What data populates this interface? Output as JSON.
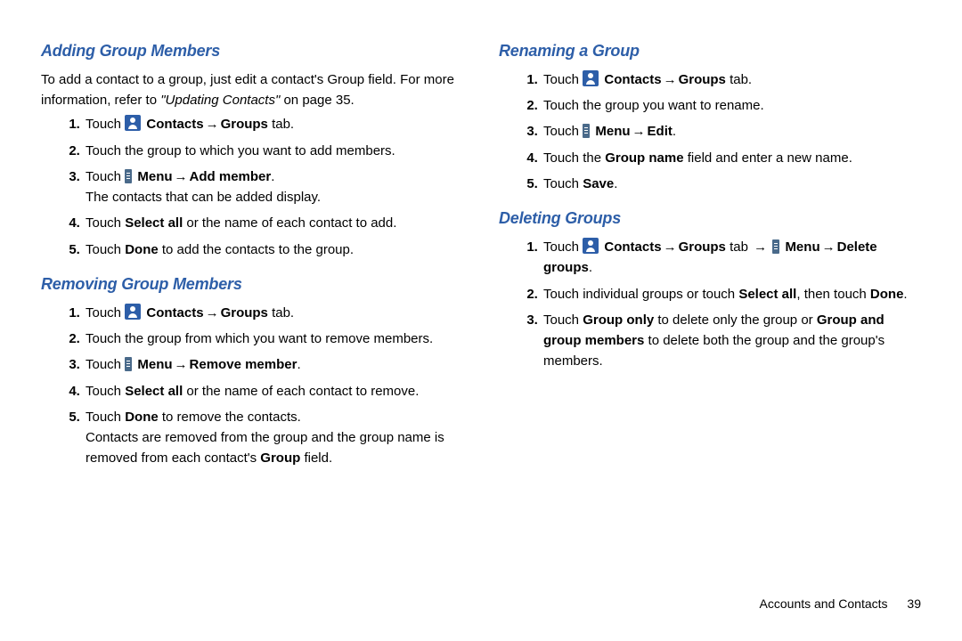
{
  "left": {
    "h1": "Adding Group Members",
    "intro1": "To add a contact to a group, just edit a contact's Group field. For more information, refer to ",
    "intro1_ref": "\"Updating Contacts\"",
    "intro1_tail": " on page 35.",
    "a1_pre": "Touch ",
    "contacts": "Contacts",
    "groups_tab": "Groups",
    "tab_word": " tab.",
    "a2": "Touch the group to which you want to add members.",
    "a3_pre": "Touch ",
    "menu_word": "Menu",
    "add_member": "Add member",
    "a3_sub": "The contacts that can be added display.",
    "a4_pre": "Touch ",
    "select_all": "Select all",
    "a4_tail": " or the name of each contact to add.",
    "a5_pre": "Touch ",
    "done": "Done",
    "a5_tail": " to add the contacts to the group.",
    "h2": "Removing Group Members",
    "r2": "Touch the group from which you want to remove members.",
    "remove_member": "Remove member",
    "r4_tail": " or the name of each contact to remove.",
    "r5_tail": " to remove the contacts.",
    "r5_sub_pre": "Contacts are removed from the group and the group name is removed from each contact's ",
    "group_word": "Group",
    "r5_sub_tail": " field."
  },
  "right": {
    "h1": "Renaming a Group",
    "n2": "Touch the group you want to rename.",
    "edit": "Edit",
    "n4_pre": "Touch the ",
    "group_name": "Group name",
    "n4_tail": " field and enter a new name.",
    "n5_pre": "Touch ",
    "save": "Save",
    "h2": "Deleting Groups",
    "d1_tab": " tab ",
    "delete_groups": "Delete groups",
    "d2_pre": "Touch individual groups or touch ",
    "d2_mid": ", then touch ",
    "d3_pre": "Touch ",
    "group_only": "Group only",
    "d3_mid": " to delete only the group or ",
    "group_and": "Group and group members",
    "d3_tail": " to delete both the group and the group's members."
  },
  "footer": {
    "section": "Accounts and Contacts",
    "page": "39"
  }
}
